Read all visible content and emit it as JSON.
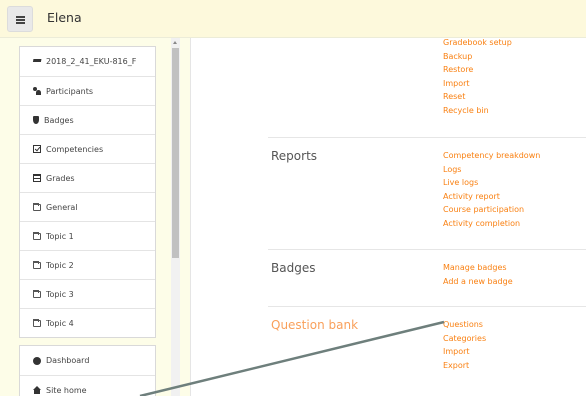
{
  "header": {
    "site_name": "Elena"
  },
  "sidebar": {
    "course_items": [
      {
        "label": "2018_2_41_EKU-816_F",
        "icon": "graduation-cap-icon"
      },
      {
        "label": "Participants",
        "icon": "users-icon"
      },
      {
        "label": "Badges",
        "icon": "shield-icon"
      },
      {
        "label": "Competencies",
        "icon": "checkbox-icon"
      },
      {
        "label": "Grades",
        "icon": "table-icon"
      },
      {
        "label": "General",
        "icon": "folder-icon"
      },
      {
        "label": "Topic 1",
        "icon": "folder-icon"
      },
      {
        "label": "Topic 2",
        "icon": "folder-icon"
      },
      {
        "label": "Topic 3",
        "icon": "folder-icon"
      },
      {
        "label": "Topic 4",
        "icon": "folder-icon"
      }
    ],
    "site_items": [
      {
        "label": "Dashboard",
        "icon": "dashboard-icon"
      },
      {
        "label": "Site home",
        "icon": "home-icon"
      }
    ]
  },
  "main": {
    "top_links": [
      "Gradebook setup",
      "Backup",
      "Restore",
      "Import",
      "Reset",
      "Recycle bin"
    ],
    "sections": [
      {
        "title": "Reports",
        "links": [
          "Competency breakdown",
          "Logs",
          "Live logs",
          "Activity report",
          "Course participation",
          "Activity completion"
        ]
      },
      {
        "title": "Badges",
        "links": [
          "Manage badges",
          "Add a new badge"
        ]
      },
      {
        "title": "Question bank",
        "links": [
          "Questions",
          "Categories",
          "Import",
          "Export"
        ]
      }
    ]
  },
  "colors": {
    "link": "#f98012",
    "active_heading": "#f9a05b",
    "annotation_line": "#6e7f7c"
  }
}
